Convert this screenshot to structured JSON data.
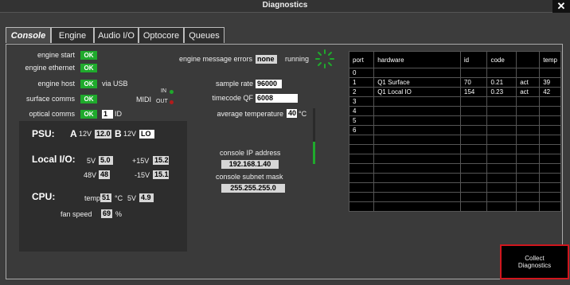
{
  "window": {
    "title": "Diagnostics",
    "close": "✕"
  },
  "tabs": [
    "Console",
    "Engine",
    "Audio I/O",
    "Optocore",
    "Queues"
  ],
  "status": {
    "engine_start": {
      "label": "engine start",
      "value": "OK"
    },
    "engine_ethernet": {
      "label": "engine ethernet",
      "value": "OK"
    },
    "engine_host": {
      "label": "engine host",
      "value": "OK",
      "suffix": "via USB"
    },
    "surface_comms": {
      "label": "surface comms",
      "value": "OK"
    },
    "optical_comms": {
      "label": "optical comms",
      "value": "OK",
      "id_value": "1",
      "id_label": "ID"
    },
    "midi": {
      "label": "MIDI",
      "in": "IN",
      "out": "OUT"
    }
  },
  "engine": {
    "msg_errors_label": "engine message errors",
    "msg_errors_value": "none",
    "running_label": "running",
    "sample_rate_label": "sample rate",
    "sample_rate_value": "96000",
    "timecode_label": "timecode QF",
    "timecode_value": "6008",
    "avg_temp_label": "average temperature",
    "avg_temp_value": "40",
    "avg_temp_unit": "°C",
    "avg_temp_level": 0.4
  },
  "network": {
    "ip_label": "console IP address",
    "ip_value": "192.168.1.40",
    "mask_label": "console subnet mask",
    "mask_value": "255.255.255.0"
  },
  "psu": {
    "label": "PSU:",
    "a_label": "A",
    "a_volt": "12V",
    "a_value": "12.0",
    "b_label": "B",
    "b_volt": "12V",
    "b_value": "LO"
  },
  "local_io": {
    "label": "Local I/O:",
    "v5_label": "5V",
    "v5_value": "5.0",
    "p15_label": "+15V",
    "p15_value": "15.2",
    "v48_label": "48V",
    "v48_value": "48",
    "m15_label": "-15V",
    "m15_value": "15.1"
  },
  "cpu": {
    "label": "CPU:",
    "temp_label": "temp",
    "temp_value": "51",
    "temp_unit": "°C",
    "v5_label": "5V",
    "v5_value": "4.9",
    "fan_label": "fan speed",
    "fan_value": "69",
    "fan_unit": "%"
  },
  "hardware_table": {
    "headers": [
      "port",
      "hardware",
      "id",
      "code",
      "",
      "temp"
    ],
    "rows": [
      [
        "0",
        "",
        "",
        "",
        "",
        ""
      ],
      [
        "1",
        "Q1 Surface",
        "70",
        "0.21",
        "act",
        "39"
      ],
      [
        "2",
        "Q1 Local IO",
        "154",
        "0.23",
        "act",
        "42"
      ],
      [
        "3",
        "",
        "",
        "",
        "",
        ""
      ],
      [
        "4",
        "",
        "",
        "",
        "",
        ""
      ],
      [
        "5",
        "",
        "",
        "",
        "",
        ""
      ],
      [
        "6",
        "",
        "",
        "",
        "",
        ""
      ],
      [
        "",
        "",
        "",
        "",
        "",
        ""
      ],
      [
        "",
        "",
        "",
        "",
        "",
        ""
      ],
      [
        "",
        "",
        "",
        "",
        "",
        ""
      ],
      [
        "",
        "",
        "",
        "",
        "",
        ""
      ],
      [
        "",
        "",
        "",
        "",
        "",
        ""
      ],
      [
        "",
        "",
        "",
        "",
        "",
        ""
      ],
      [
        "",
        "",
        "",
        "",
        "",
        ""
      ],
      [
        "",
        "",
        "",
        "",
        "",
        ""
      ]
    ]
  },
  "actions": {
    "collect_line1": "Collect",
    "collect_line2": "Diagnostics"
  },
  "colors": {
    "ok": "#1faa2c",
    "accent_red": "#d0161d",
    "background": "#3c3c3c"
  }
}
